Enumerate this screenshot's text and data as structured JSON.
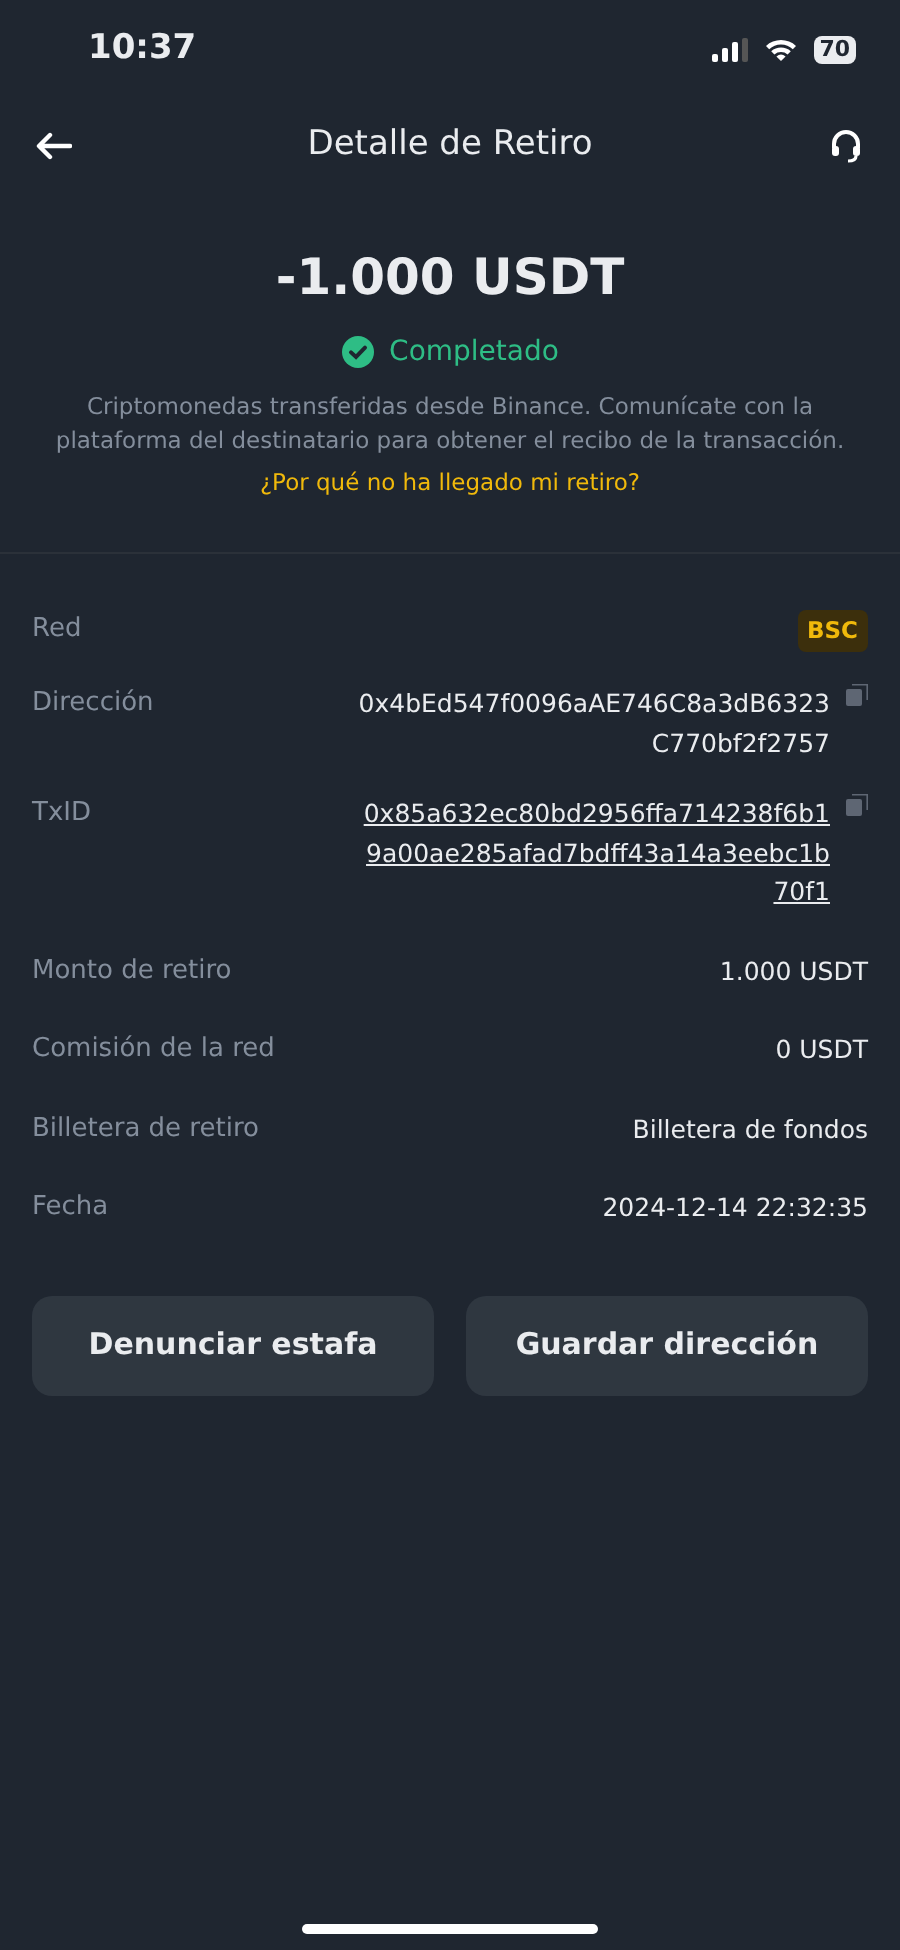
{
  "status_bar": {
    "time": "10:37",
    "battery": "70"
  },
  "header": {
    "title": "Detalle de Retiro"
  },
  "amount": "-1.000 USDT",
  "status": {
    "label": "Completado",
    "kind": "success"
  },
  "description": "Criptomonedas transferidas desde Binance. Comunícate con la plataforma del destinatario para obtener el recibo de la transacción.",
  "help_link": "¿Por qué no ha llegado mi retiro?",
  "details": [
    {
      "label": "Red",
      "kind": "badge",
      "value_lines": [
        "BSC"
      ]
    },
    {
      "label": "Dirección",
      "kind": "copy",
      "value_lines": [
        "0x4bEd547f0096aAE746C8a3dB6323",
        "C770bf2f2757"
      ]
    },
    {
      "label": "TxID",
      "kind": "copy-link",
      "value_lines": [
        "0x85a632ec80bd2956ffa714238f6b1",
        "9a00ae285afad7bdff43a14a3eebc1b",
        "70f1"
      ]
    },
    {
      "label": "Monto de retiro",
      "kind": "text",
      "value_lines": [
        "1.000 USDT"
      ]
    },
    {
      "label": "Comisión de la red",
      "kind": "text",
      "value_lines": [
        "0 USDT"
      ]
    },
    {
      "label": "Billetera de retiro",
      "kind": "text",
      "value_lines": [
        "Billetera de fondos"
      ]
    },
    {
      "label": "Fecha",
      "kind": "text",
      "value_lines": [
        "2024-12-14 22:32:35"
      ]
    }
  ],
  "buttons": [
    "Denunciar estafa",
    "Guardar dirección"
  ]
}
